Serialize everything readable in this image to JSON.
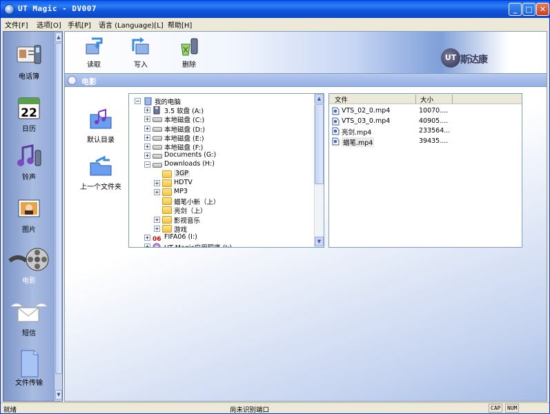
{
  "window": {
    "title": "UT Magic - DV007"
  },
  "menubar": [
    {
      "label": "文件[F]"
    },
    {
      "label": "选项[O]"
    },
    {
      "label": "手机[P]"
    },
    {
      "label": "语言 (Language)[L]"
    },
    {
      "label": "帮助[H]"
    }
  ],
  "sidebar": {
    "items": [
      {
        "label": "电话簿",
        "icon": "phonebook-icon"
      },
      {
        "label": "日历",
        "icon": "calendar-icon",
        "calendar_day": "22"
      },
      {
        "label": "铃声",
        "icon": "ringtone-icon"
      },
      {
        "label": "图片",
        "icon": "picture-icon"
      },
      {
        "label": "电影",
        "icon": "movie-icon",
        "active": true
      },
      {
        "label": "短信",
        "icon": "sms-icon"
      },
      {
        "label": "文件传输",
        "icon": "file-transfer-icon"
      }
    ]
  },
  "toolbar": {
    "read": "读取",
    "write": "写入",
    "delete": "删除",
    "logo_mark": "UT",
    "logo_text": "斯达康"
  },
  "section": {
    "title": "电影"
  },
  "nav": {
    "default_dir": "默认目录",
    "parent_dir": "上一个文件夹"
  },
  "tree": {
    "items": [
      {
        "label": "我的电脑",
        "level": 0,
        "expander": "−",
        "icon": "computer-icon"
      },
      {
        "label": "3.5 软盘 (A:)",
        "level": 1,
        "expander": "+",
        "icon": "floppy-icon"
      },
      {
        "label": "本地磁盘 (C:)",
        "level": 1,
        "expander": "+",
        "icon": "drive-icon"
      },
      {
        "label": "本地磁盘 (D:)",
        "level": 1,
        "expander": "+",
        "icon": "drive-icon"
      },
      {
        "label": "本地磁盘 (E:)",
        "level": 1,
        "expander": "+",
        "icon": "drive-icon"
      },
      {
        "label": "本地磁盘 (F:)",
        "level": 1,
        "expander": "+",
        "icon": "drive-icon"
      },
      {
        "label": "Documents (G:)",
        "level": 1,
        "expander": "+",
        "icon": "drive-icon"
      },
      {
        "label": "Downloads (H:)",
        "level": 1,
        "expander": "−",
        "icon": "drive-icon"
      },
      {
        "label": "3GP",
        "level": 2,
        "expander": "",
        "icon": "folder-icon",
        "selected": true
      },
      {
        "label": "HDTV",
        "level": 2,
        "expander": "+",
        "icon": "folder-icon"
      },
      {
        "label": "MP3",
        "level": 2,
        "expander": "+",
        "icon": "folder-icon"
      },
      {
        "label": "蜡笔小新（上）",
        "level": 2,
        "expander": "",
        "icon": "folder-icon"
      },
      {
        "label": "亮剑（上）",
        "level": 2,
        "expander": "",
        "icon": "folder-icon"
      },
      {
        "label": "影视音乐",
        "level": 2,
        "expander": "+",
        "icon": "folder-icon"
      },
      {
        "label": "游戏",
        "level": 2,
        "expander": "+",
        "icon": "folder-icon"
      },
      {
        "label": "FIFA06 (I:)",
        "level": 1,
        "expander": "+",
        "icon": "fifa-drive-icon"
      },
      {
        "label": "UT Magic应用程序 (J:)",
        "level": 1,
        "expander": "+",
        "icon": "cd-icon"
      }
    ]
  },
  "filelist": {
    "columns": [
      "文件",
      "大小"
    ],
    "rows": [
      {
        "name": "VTS_02_0.mp4",
        "size": "10070...."
      },
      {
        "name": "VTS_03_0.mp4",
        "size": "40905...."
      },
      {
        "name": "亮剑.mp4",
        "size": "233564..."
      },
      {
        "name": "蜡笔.mp4",
        "size": "39435....",
        "selected": true
      }
    ]
  },
  "status": {
    "left": "就绪",
    "center": "尚未识别端口",
    "cap": "CAP",
    "num": "NUM"
  },
  "colors": {
    "title_bar": "#0a5fe9",
    "section_bar": "#95afe3",
    "sidebar": "#8aa2d2"
  }
}
